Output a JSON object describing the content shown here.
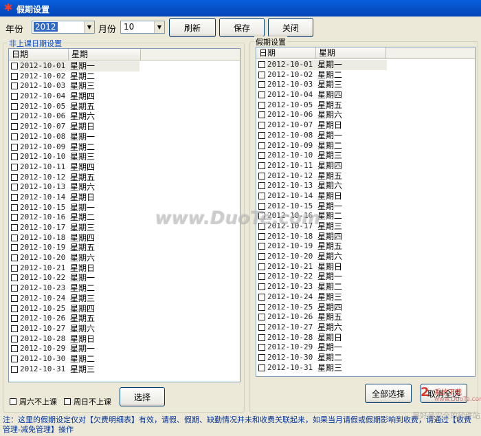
{
  "window": {
    "title": "假期设置"
  },
  "toolbar": {
    "year_label": "年份",
    "year_value": "2012",
    "month_label": "月份",
    "month_value": "10",
    "refresh_label": "刷新",
    "save_label": "保存",
    "close_label": "关闭"
  },
  "left_panel": {
    "title": "非上课日期设置",
    "col_date": "日期",
    "col_weekday": "星期",
    "sat_label": "周六不上课",
    "sun_label": "周日不上课",
    "select_label": "选择"
  },
  "right_panel": {
    "title": "假期设置",
    "col_date": "日期",
    "col_weekday": "星期",
    "select_all_label": "全部选择",
    "deselect_label": "取消全选"
  },
  "rows": [
    {
      "date": "2012-10-01",
      "weekday": "星期一"
    },
    {
      "date": "2012-10-02",
      "weekday": "星期二"
    },
    {
      "date": "2012-10-03",
      "weekday": "星期三"
    },
    {
      "date": "2012-10-04",
      "weekday": "星期四"
    },
    {
      "date": "2012-10-05",
      "weekday": "星期五"
    },
    {
      "date": "2012-10-06",
      "weekday": "星期六"
    },
    {
      "date": "2012-10-07",
      "weekday": "星期日"
    },
    {
      "date": "2012-10-08",
      "weekday": "星期一"
    },
    {
      "date": "2012-10-09",
      "weekday": "星期二"
    },
    {
      "date": "2012-10-10",
      "weekday": "星期三"
    },
    {
      "date": "2012-10-11",
      "weekday": "星期四"
    },
    {
      "date": "2012-10-12",
      "weekday": "星期五"
    },
    {
      "date": "2012-10-13",
      "weekday": "星期六"
    },
    {
      "date": "2012-10-14",
      "weekday": "星期日"
    },
    {
      "date": "2012-10-15",
      "weekday": "星期一"
    },
    {
      "date": "2012-10-16",
      "weekday": "星期二"
    },
    {
      "date": "2012-10-17",
      "weekday": "星期三"
    },
    {
      "date": "2012-10-18",
      "weekday": "星期四"
    },
    {
      "date": "2012-10-19",
      "weekday": "星期五"
    },
    {
      "date": "2012-10-20",
      "weekday": "星期六"
    },
    {
      "date": "2012-10-21",
      "weekday": "星期日"
    },
    {
      "date": "2012-10-22",
      "weekday": "星期一"
    },
    {
      "date": "2012-10-23",
      "weekday": "星期二"
    },
    {
      "date": "2012-10-24",
      "weekday": "星期三"
    },
    {
      "date": "2012-10-25",
      "weekday": "星期四"
    },
    {
      "date": "2012-10-26",
      "weekday": "星期五"
    },
    {
      "date": "2012-10-27",
      "weekday": "星期六"
    },
    {
      "date": "2012-10-28",
      "weekday": "星期日"
    },
    {
      "date": "2012-10-29",
      "weekday": "星期一"
    },
    {
      "date": "2012-10-30",
      "weekday": "星期二"
    },
    {
      "date": "2012-10-31",
      "weekday": "星期三"
    }
  ],
  "note": "注：这里的假期设定仅对【欠费明细表】有效，请假、假期、缺勤情况并未和收费关联起来，如果当月请假或假期影响到收费，请通过【收费管理-减免管理】操作",
  "watermark": {
    "center": "www.DuoTe.com",
    "logo_num": "2",
    "logo_cn": "系统下载",
    "logo_url": "www.DuoTe.com",
    "logo_bottom": "最好最安全的软件站"
  },
  "icons": {
    "app": "app-icon",
    "dropdown": "chevron-down-icon"
  }
}
